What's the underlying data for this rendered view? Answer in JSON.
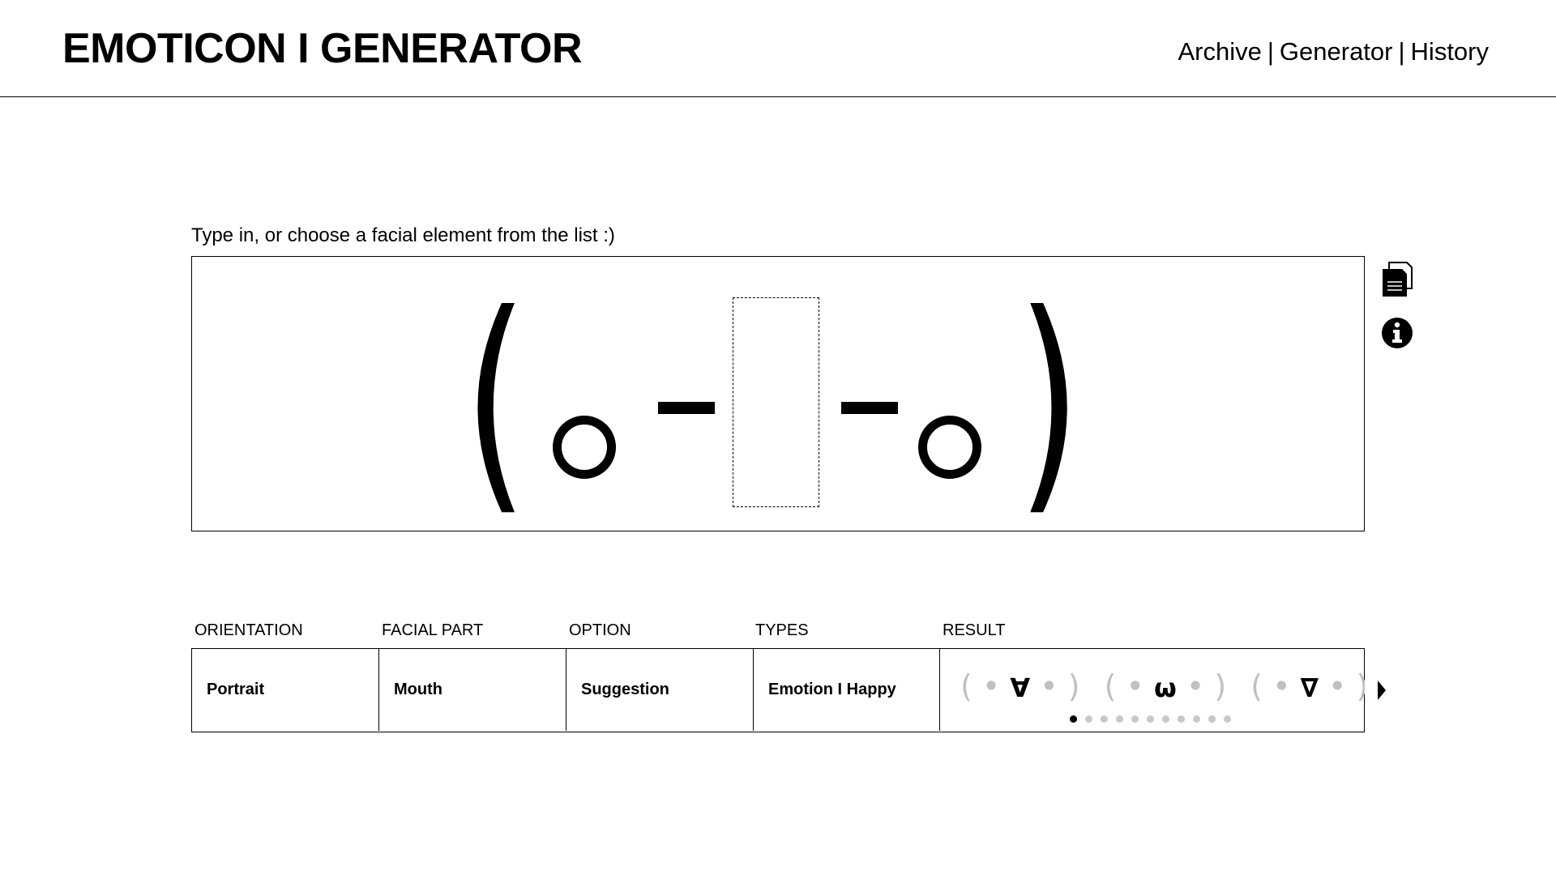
{
  "header": {
    "title": "EMOTICON I GENERATOR",
    "nav": [
      "Archive",
      "Generator",
      "History"
    ],
    "separator": "|"
  },
  "editor": {
    "prompt": "Type in, or choose a facial element from the list :)",
    "left_paren": "(",
    "right_paren": ")"
  },
  "icons": {
    "copy": "copy-document-icon",
    "info": "info-icon"
  },
  "panel": {
    "labels": {
      "orientation": "ORIENTATION",
      "facial_part": "FACIAL PART",
      "option": "OPTION",
      "types": "TYPES",
      "result": "RESULT"
    },
    "values": {
      "orientation": "Portrait",
      "facial_part": "Mouth",
      "option": "Suggestion",
      "types": "Emotion I Happy"
    },
    "results": [
      {
        "left": "( • ",
        "mouth": "∀",
        "right": " • )"
      },
      {
        "left": "( • ",
        "mouth": "ω",
        "right": " • )"
      },
      {
        "left": "( • ",
        "mouth": "∇",
        "right": " • )"
      },
      {
        "left": "( • ",
        "mouth": "_",
        "right": ""
      }
    ],
    "pagination": {
      "total": 11,
      "active": 1
    }
  }
}
